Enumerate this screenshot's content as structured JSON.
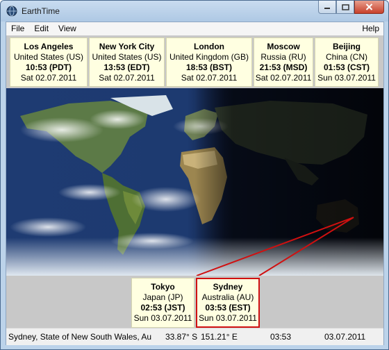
{
  "window": {
    "title": "EarthTime"
  },
  "menu": {
    "file": "File",
    "edit": "Edit",
    "view": "View",
    "help": "Help"
  },
  "clocks_top": [
    {
      "city": "Los Angeles",
      "country": "United States (US)",
      "time": "10:53 (PDT)",
      "date": "Sat 02.07.2011"
    },
    {
      "city": "New York City",
      "country": "United States (US)",
      "time": "13:53 (EDT)",
      "date": "Sat 02.07.2011"
    },
    {
      "city": "London",
      "country": "United Kingdom (GB)",
      "time": "18:53 (BST)",
      "date": "Sat 02.07.2011"
    },
    {
      "city": "Moscow",
      "country": "Russia (RU)",
      "time": "21:53 (MSD)",
      "date": "Sat 02.07.2011"
    },
    {
      "city": "Beijing",
      "country": "China (CN)",
      "time": "01:53 (CST)",
      "date": "Sun 03.07.2011"
    }
  ],
  "clocks_bottom": [
    {
      "city": "Tokyo",
      "country": "Japan (JP)",
      "time": "02:53 (JST)",
      "date": "Sun 03.07.2011"
    },
    {
      "city": "Sydney",
      "country": "Australia (AU)",
      "time": "03:53 (EST)",
      "date": "Sun 03.07.2011",
      "selected": true
    }
  ],
  "status": {
    "location": "Sydney, State of New South Wales, Au",
    "lat": "33.87° S",
    "lon": "151.21° E",
    "time": "03:53",
    "date": "03.07.2011"
  },
  "colors": {
    "selection_outline": "#d01010",
    "card_background": "#ffffe1"
  }
}
